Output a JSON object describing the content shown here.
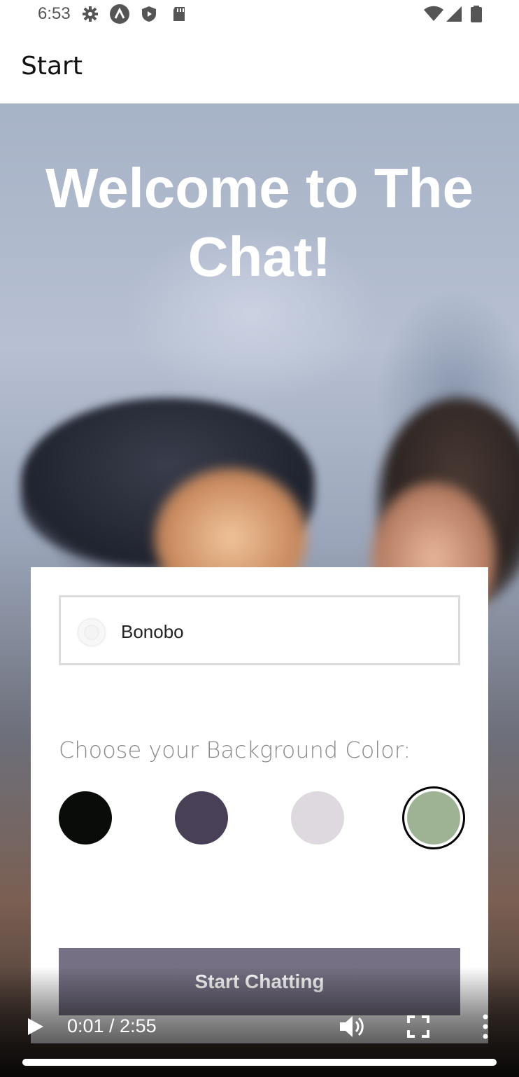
{
  "status_bar": {
    "time": "6:53",
    "left_icons": [
      "settings-icon",
      "app-icon",
      "shield-play-icon",
      "sd-card-icon"
    ],
    "right_icons": [
      "wifi-icon",
      "signal-icon",
      "battery-icon"
    ]
  },
  "app_bar": {
    "title": "Start"
  },
  "hero": {
    "welcome_text": "Welcome to The Chat!"
  },
  "form": {
    "name_value": "Bonobo",
    "choose_label": "Choose your Background Color:",
    "colors": [
      {
        "hex": "#090C08",
        "selected": false
      },
      {
        "hex": "#474056",
        "selected": false
      },
      {
        "hex": "#DED9DE",
        "selected": false
      },
      {
        "hex": "#9DB394",
        "selected": true
      }
    ],
    "start_button": "Start Chatting"
  },
  "video": {
    "time_display": "0:01 / 2:55",
    "progress_fraction": 0.006
  }
}
